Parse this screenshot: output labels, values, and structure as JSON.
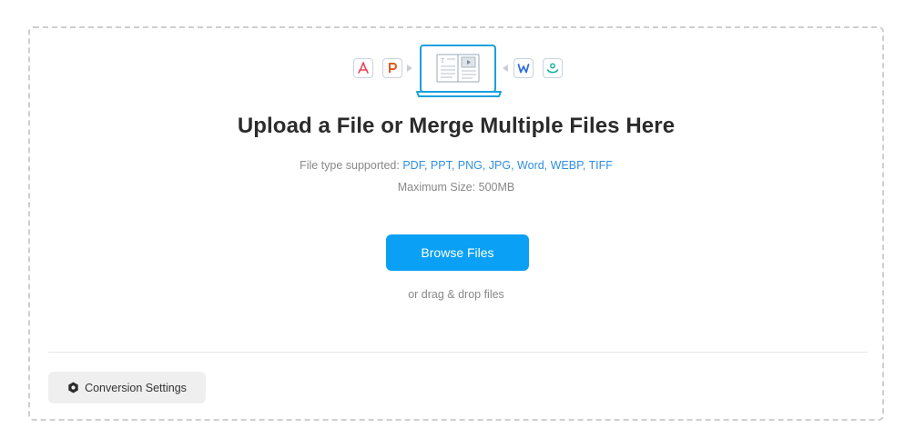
{
  "upload": {
    "title": "Upload a File or Merge Multiple Files Here",
    "supported_prefix": "File type supported: ",
    "supported_types": "PDF, PPT, PNG, JPG, Word, WEBP, TIFF",
    "max_size": "Maximum Size: 500MB",
    "browse_label": "Browse Files",
    "drag_label": "or drag & drop files"
  },
  "icons": {
    "left": [
      "pdf-icon",
      "ppt-icon"
    ],
    "center": "laptop-document-icon",
    "right": [
      "word-icon",
      "image-icon"
    ]
  },
  "footer": {
    "settings_label": "Conversion Settings",
    "settings_icon": "gear-icon"
  },
  "colors": {
    "accent": "#0aa0f5",
    "link": "#2f8fe0",
    "pdf": "#e6455a",
    "ppt": "#e05a1c",
    "word": "#2f6fe0",
    "image": "#19b3a0",
    "laptop": "#1aa0dd"
  }
}
